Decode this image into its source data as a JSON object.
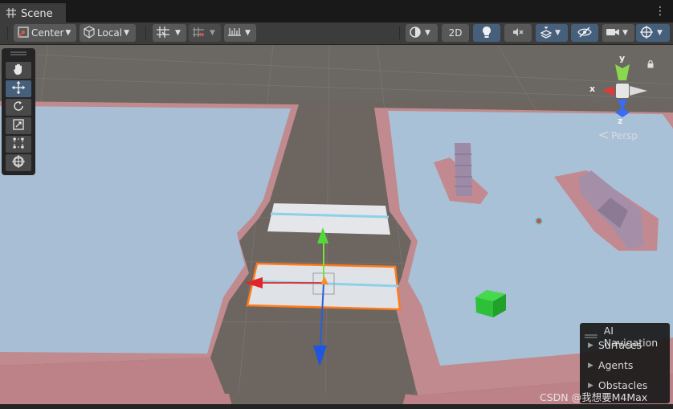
{
  "tab": {
    "title": "Scene",
    "grid_icon": "grid-icon",
    "menu_icon": "kebab-menu-icon"
  },
  "toolbar": {
    "pivot_label": "Center",
    "space_label": "Local",
    "mode_2d_label": "2D",
    "icons": [
      "pivot-icon",
      "local-space-icon",
      "grid-snap-icon",
      "increment-snap-icon",
      "ruler-icon",
      "shading-icon",
      "lighting-icon",
      "audio-mute-icon",
      "effects-icon",
      "hidden-objects-icon",
      "camera-icon",
      "gizmos-icon"
    ]
  },
  "tools": [
    {
      "name": "hand-tool",
      "icon": "hand-icon"
    },
    {
      "name": "move-tool",
      "icon": "move-icon",
      "active": true
    },
    {
      "name": "rotate-tool",
      "icon": "rotate-icon"
    },
    {
      "name": "scale-tool",
      "icon": "scale-icon"
    },
    {
      "name": "rect-tool",
      "icon": "rect-icon"
    },
    {
      "name": "transform-tool",
      "icon": "transform-icon"
    }
  ],
  "orientation_gizmo": {
    "x_label": "x",
    "y_label": "y",
    "z_label": "z",
    "projection_label": "Persp"
  },
  "ai_navigation": {
    "title": "AI Navigation",
    "items": [
      "Surfaces",
      "Agents",
      "Obstacles"
    ]
  },
  "watermark": "CSDN @我想要M4Max",
  "colors": {
    "navmesh_blue": "#a7c0d6",
    "navmesh_edge": "#c78a90",
    "ground": "#6e6661",
    "axis_x": "#e0393a",
    "axis_y": "#3bd62e",
    "axis_z": "#2a5fd6",
    "accent": "#46607c"
  }
}
